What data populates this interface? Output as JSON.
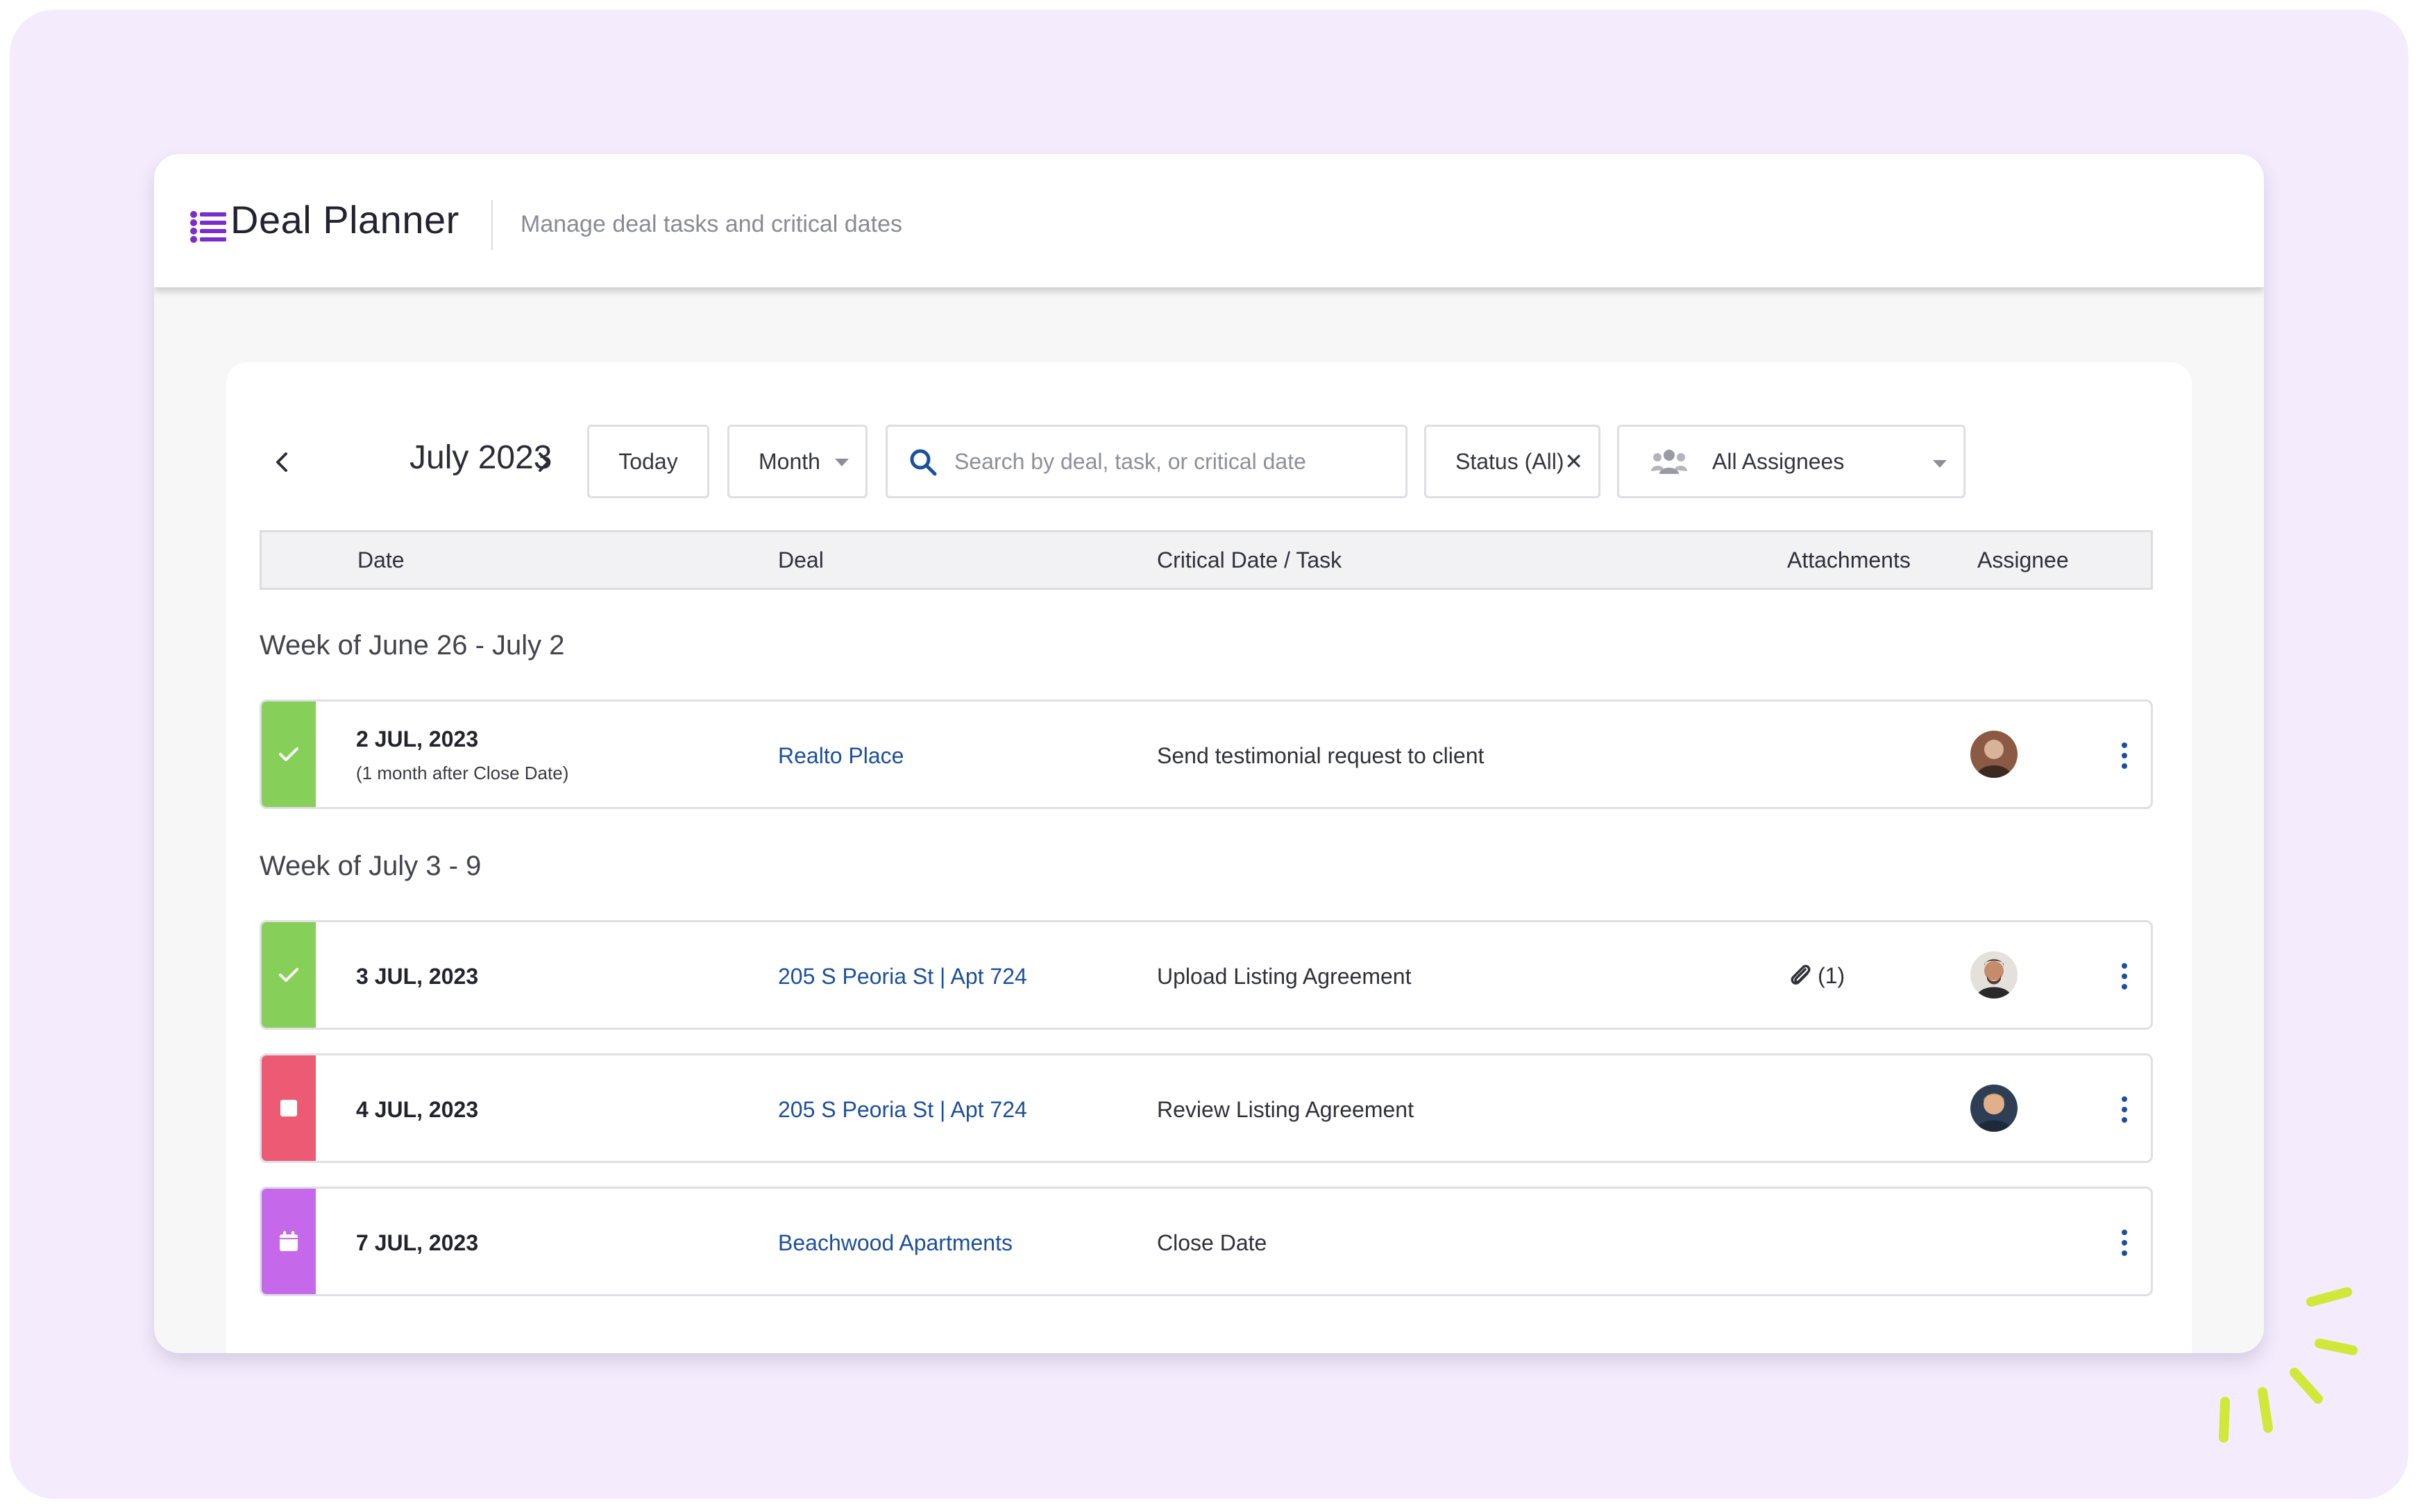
{
  "header": {
    "title": "Deal Planner",
    "subtitle": "Manage deal tasks and critical dates"
  },
  "toolbar": {
    "month_label": "July 2023",
    "today_label": "Today",
    "view_select": "Month",
    "search_placeholder": "Search by deal, task, or critical date",
    "search_value": "",
    "status_filter": "Status (All)",
    "assignee_filter": "All Assignees"
  },
  "table": {
    "columns": {
      "date": "Date",
      "deal": "Deal",
      "task": "Critical Date / Task",
      "attachments": "Attachments",
      "assignee": "Assignee"
    }
  },
  "weeks": [
    {
      "label": "Week of June 26 - July 2",
      "rows": [
        {
          "status": "completed",
          "status_color": "#86cf58",
          "icon": "check-icon",
          "date": "2 JUL, 2023",
          "date_note": "(1 month after Close Date)",
          "deal": "Realto Place",
          "task": "Send testimonial request to client",
          "attachments": "",
          "avatar_color": "#8a5a44"
        }
      ]
    },
    {
      "label": "Week of July 3 - 9",
      "rows": [
        {
          "status": "completed",
          "status_color": "#86cf58",
          "icon": "check-icon",
          "date": "3 JUL, 2023",
          "deal": "205 S Peoria St | Apt 724",
          "task": "Upload Listing Agreement",
          "attachments": "(1)",
          "avatar_color": "#5b3a2c"
        },
        {
          "status": "overdue",
          "status_color": "#ec5b73",
          "icon": "checkbox-icon",
          "date": "4 JUL, 2023",
          "deal": "205 S Peoria St | Apt 724",
          "task": "Review Listing Agreement",
          "attachments": "",
          "avatar_color": "#2d3e55"
        },
        {
          "status": "critical-date",
          "status_color": "#c569ea",
          "icon": "calendar-icon",
          "date": "7 JUL, 2023",
          "deal": "Beachwood Apartments",
          "task": "Close Date",
          "attachments": ""
        }
      ]
    }
  ],
  "colors": {
    "brand_purple": "#7b2cc9",
    "link_blue": "#1c4f9c",
    "accent_lime": "#cfe83a"
  }
}
